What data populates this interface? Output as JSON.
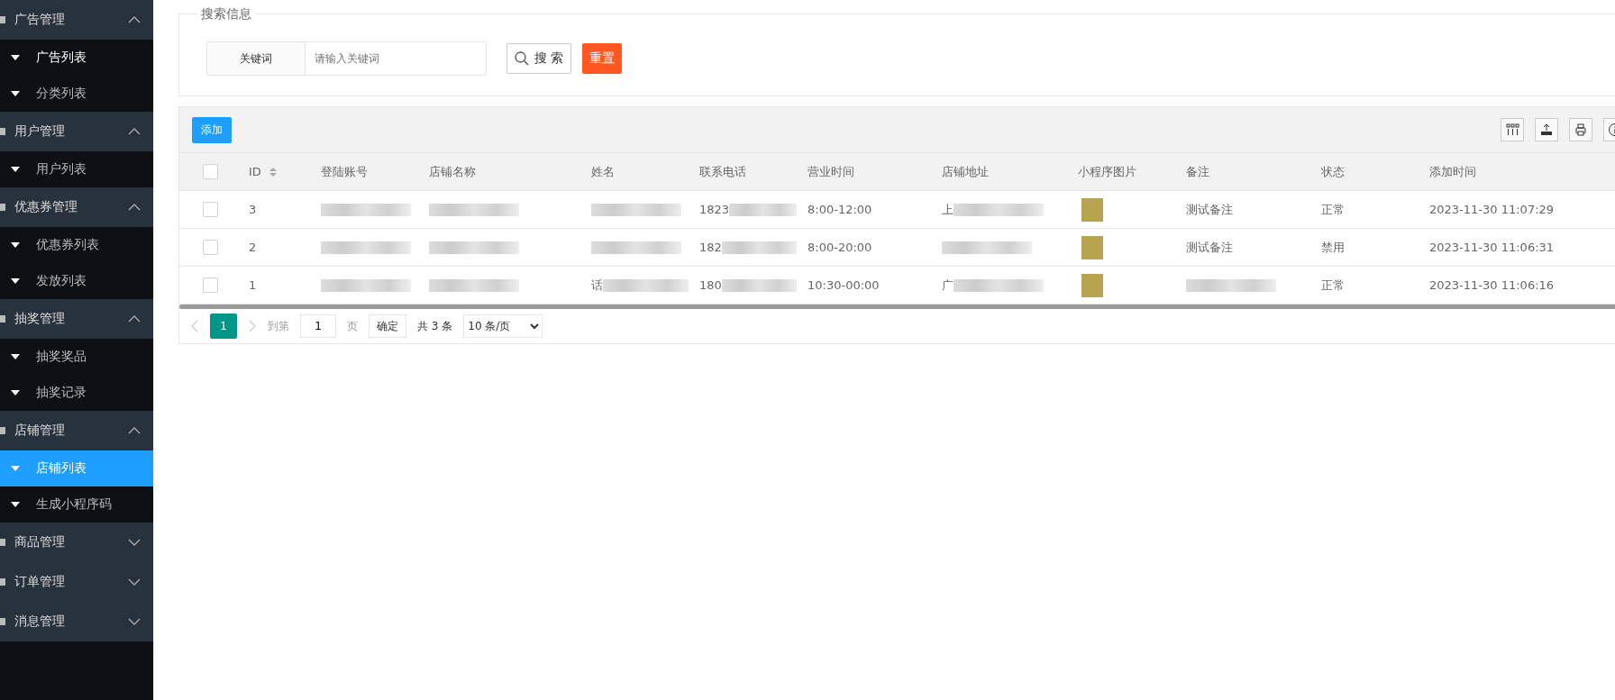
{
  "sidebar": {
    "groups": [
      {
        "title": "广告管理",
        "expanded": true,
        "items": [
          {
            "label": "广告列表",
            "selected": false,
            "highlight": true
          },
          {
            "label": "分类列表",
            "selected": false,
            "highlight": false
          }
        ]
      },
      {
        "title": "用户管理",
        "expanded": true,
        "items": [
          {
            "label": "用户列表",
            "selected": false,
            "highlight": false
          }
        ]
      },
      {
        "title": "优惠券管理",
        "expanded": true,
        "items": [
          {
            "label": "优惠券列表",
            "selected": false,
            "highlight": false
          },
          {
            "label": "发放列表",
            "selected": false,
            "highlight": false
          }
        ]
      },
      {
        "title": "抽奖管理",
        "expanded": true,
        "items": [
          {
            "label": "抽奖奖品",
            "selected": false,
            "highlight": false
          },
          {
            "label": "抽奖记录",
            "selected": false,
            "highlight": false
          }
        ]
      },
      {
        "title": "店铺管理",
        "expanded": true,
        "items": [
          {
            "label": "店铺列表",
            "selected": true,
            "highlight": true
          },
          {
            "label": "生成小程序码",
            "selected": false,
            "highlight": false
          }
        ]
      },
      {
        "title": "商品管理",
        "expanded": false
      },
      {
        "title": "订单管理",
        "expanded": false
      },
      {
        "title": "消息管理",
        "expanded": false
      }
    ]
  },
  "search": {
    "legend": "搜索信息",
    "label": "关键词",
    "placeholder": "请输入关键词",
    "search_button": "搜 索",
    "reset_button": "重置"
  },
  "table": {
    "add_button": "添加",
    "all_checked": false,
    "columns": [
      "ID",
      "登陆账号",
      "店铺名称",
      "姓名",
      "联系电话",
      "营业时间",
      "店铺地址",
      "小程序图片",
      "备注",
      "状态",
      "添加时间"
    ],
    "rows": [
      {
        "checked": false,
        "cells": [
          {
            "text": "3"
          },
          {
            "redacted": true
          },
          {
            "redacted": true
          },
          {
            "redacted": true
          },
          {
            "text": "1823",
            "redacted": true
          },
          {
            "text": "8:00-12:00"
          },
          {
            "text": "上",
            "redacted": true
          },
          {
            "kind": "image"
          },
          {
            "text": "测试备注"
          },
          {
            "text": "正常"
          },
          {
            "text": "2023-11-30 11:07:29"
          }
        ]
      },
      {
        "checked": false,
        "cells": [
          {
            "text": "2"
          },
          {
            "redacted": true
          },
          {
            "redacted": true
          },
          {
            "redacted": true
          },
          {
            "text": "182",
            "redacted": true
          },
          {
            "text": "8:00-20:00"
          },
          {
            "redacted": true
          },
          {
            "kind": "image"
          },
          {
            "text": "测试备注"
          },
          {
            "text": "禁用"
          },
          {
            "text": "2023-11-30 11:06:31"
          }
        ]
      },
      {
        "checked": false,
        "cells": [
          {
            "text": "1"
          },
          {
            "redacted": true
          },
          {
            "redacted": true
          },
          {
            "text": "话",
            "redacted": true
          },
          {
            "text": "180",
            "redacted": true
          },
          {
            "text": "10:30-00:00"
          },
          {
            "text": "广",
            "redacted": true
          },
          {
            "kind": "image"
          },
          {
            "redacted": true
          },
          {
            "text": "正常"
          },
          {
            "text": "2023-11-30 11:06:16"
          }
        ]
      }
    ]
  },
  "pagination": {
    "pages": [
      {
        "label": "1",
        "selected": true
      }
    ],
    "goto_label": "到第",
    "page_input": "1",
    "page_suffix": "页",
    "confirm_button": "确定",
    "total": "共 3 条",
    "page_size": "10 条/页"
  }
}
